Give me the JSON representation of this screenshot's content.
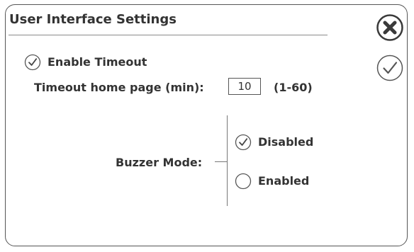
{
  "dialog": {
    "title": "User Interface Settings"
  },
  "actions": {
    "close_icon": "close-circle-x",
    "confirm_icon": "check-circle"
  },
  "timeout": {
    "enable_label": "Enable Timeout",
    "enable_checked": true,
    "home_page_label": "Timeout home page (min):",
    "home_page_value": "10",
    "range_hint": "(1-60)"
  },
  "buzzer": {
    "label": "Buzzer Mode:",
    "options": [
      {
        "label": "Disabled",
        "selected": true
      },
      {
        "label": "Enabled",
        "selected": false
      }
    ]
  },
  "colors": {
    "border": "#555555",
    "text": "#333333",
    "close_icon": "#3a3a3a"
  }
}
